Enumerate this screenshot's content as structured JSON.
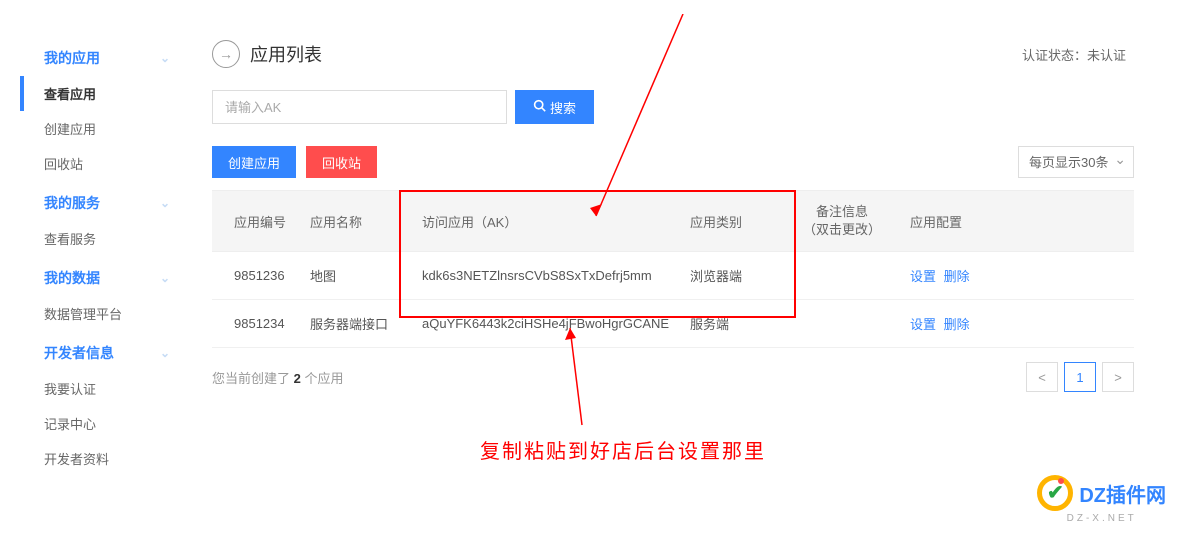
{
  "sidebar": {
    "groups": [
      {
        "title": "我的应用",
        "items": [
          {
            "label": "查看应用",
            "active": true
          },
          {
            "label": "创建应用"
          },
          {
            "label": "回收站"
          }
        ]
      },
      {
        "title": "我的服务",
        "items": [
          {
            "label": "查看服务"
          }
        ]
      },
      {
        "title": "我的数据",
        "items": [
          {
            "label": "数据管理平台"
          }
        ]
      },
      {
        "title": "开发者信息",
        "items": [
          {
            "label": "我要认证"
          },
          {
            "label": "记录中心"
          },
          {
            "label": "开发者资料"
          }
        ]
      }
    ]
  },
  "header": {
    "title": "应用列表",
    "auth_label": "认证状态：",
    "auth_value": "未认证"
  },
  "search": {
    "placeholder": "请输入AK",
    "button": "搜索"
  },
  "actions": {
    "create": "创建应用",
    "recycle": "回收站",
    "page_size": "每页显示30条"
  },
  "table": {
    "headers": {
      "id": "应用编号",
      "name": "应用名称",
      "ak": "访问应用（AK）",
      "type": "应用类别",
      "remark_line1": "备注信息",
      "remark_line2": "（双击更改）",
      "config": "应用配置"
    },
    "rows": [
      {
        "id": "9851236",
        "name": "地图",
        "ak": "kdk6s3NETZlnsrsCVbS8SxTxDefrj5mm",
        "type": "浏览器端",
        "set": "设置",
        "del": "删除"
      },
      {
        "id": "9851234",
        "name": "服务器端接口",
        "ak": "aQuYFK6443k2ciHSHe4jFBwoHgrGCANE",
        "type": "服务端",
        "set": "设置",
        "del": "删除"
      }
    ]
  },
  "footer": {
    "count_prefix": "您当前创建了 ",
    "count": "2",
    "count_suffix": " 个应用"
  },
  "pager": {
    "prev": "<",
    "page": "1",
    "next": ">"
  },
  "annotation": {
    "text": "复制粘贴到好店后台设置那里"
  },
  "watermark": {
    "main": "DZ插件网",
    "sub": "DZ-X.NET"
  }
}
